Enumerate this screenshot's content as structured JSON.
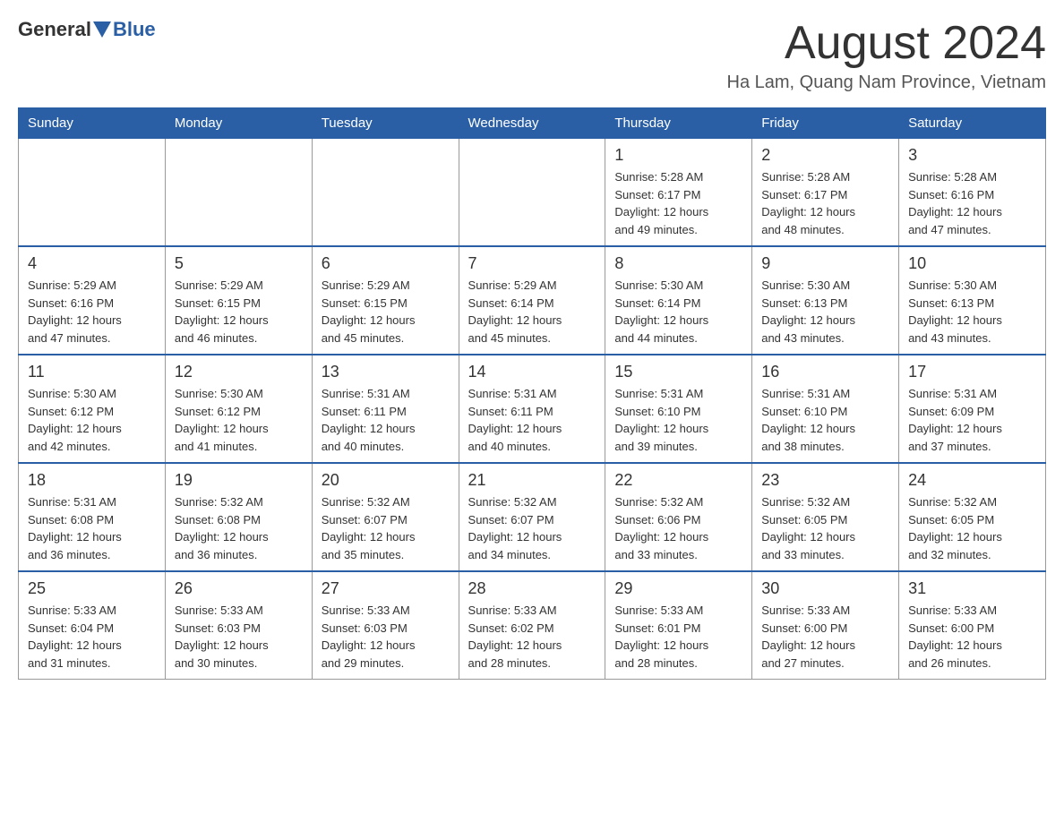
{
  "header": {
    "logo_general": "General",
    "logo_blue": "Blue",
    "month_title": "August 2024",
    "location": "Ha Lam, Quang Nam Province, Vietnam"
  },
  "weekdays": [
    "Sunday",
    "Monday",
    "Tuesday",
    "Wednesday",
    "Thursday",
    "Friday",
    "Saturday"
  ],
  "weeks": [
    [
      {
        "day": "",
        "info": ""
      },
      {
        "day": "",
        "info": ""
      },
      {
        "day": "",
        "info": ""
      },
      {
        "day": "",
        "info": ""
      },
      {
        "day": "1",
        "info": "Sunrise: 5:28 AM\nSunset: 6:17 PM\nDaylight: 12 hours\nand 49 minutes."
      },
      {
        "day": "2",
        "info": "Sunrise: 5:28 AM\nSunset: 6:17 PM\nDaylight: 12 hours\nand 48 minutes."
      },
      {
        "day": "3",
        "info": "Sunrise: 5:28 AM\nSunset: 6:16 PM\nDaylight: 12 hours\nand 47 minutes."
      }
    ],
    [
      {
        "day": "4",
        "info": "Sunrise: 5:29 AM\nSunset: 6:16 PM\nDaylight: 12 hours\nand 47 minutes."
      },
      {
        "day": "5",
        "info": "Sunrise: 5:29 AM\nSunset: 6:15 PM\nDaylight: 12 hours\nand 46 minutes."
      },
      {
        "day": "6",
        "info": "Sunrise: 5:29 AM\nSunset: 6:15 PM\nDaylight: 12 hours\nand 45 minutes."
      },
      {
        "day": "7",
        "info": "Sunrise: 5:29 AM\nSunset: 6:14 PM\nDaylight: 12 hours\nand 45 minutes."
      },
      {
        "day": "8",
        "info": "Sunrise: 5:30 AM\nSunset: 6:14 PM\nDaylight: 12 hours\nand 44 minutes."
      },
      {
        "day": "9",
        "info": "Sunrise: 5:30 AM\nSunset: 6:13 PM\nDaylight: 12 hours\nand 43 minutes."
      },
      {
        "day": "10",
        "info": "Sunrise: 5:30 AM\nSunset: 6:13 PM\nDaylight: 12 hours\nand 43 minutes."
      }
    ],
    [
      {
        "day": "11",
        "info": "Sunrise: 5:30 AM\nSunset: 6:12 PM\nDaylight: 12 hours\nand 42 minutes."
      },
      {
        "day": "12",
        "info": "Sunrise: 5:30 AM\nSunset: 6:12 PM\nDaylight: 12 hours\nand 41 minutes."
      },
      {
        "day": "13",
        "info": "Sunrise: 5:31 AM\nSunset: 6:11 PM\nDaylight: 12 hours\nand 40 minutes."
      },
      {
        "day": "14",
        "info": "Sunrise: 5:31 AM\nSunset: 6:11 PM\nDaylight: 12 hours\nand 40 minutes."
      },
      {
        "day": "15",
        "info": "Sunrise: 5:31 AM\nSunset: 6:10 PM\nDaylight: 12 hours\nand 39 minutes."
      },
      {
        "day": "16",
        "info": "Sunrise: 5:31 AM\nSunset: 6:10 PM\nDaylight: 12 hours\nand 38 minutes."
      },
      {
        "day": "17",
        "info": "Sunrise: 5:31 AM\nSunset: 6:09 PM\nDaylight: 12 hours\nand 37 minutes."
      }
    ],
    [
      {
        "day": "18",
        "info": "Sunrise: 5:31 AM\nSunset: 6:08 PM\nDaylight: 12 hours\nand 36 minutes."
      },
      {
        "day": "19",
        "info": "Sunrise: 5:32 AM\nSunset: 6:08 PM\nDaylight: 12 hours\nand 36 minutes."
      },
      {
        "day": "20",
        "info": "Sunrise: 5:32 AM\nSunset: 6:07 PM\nDaylight: 12 hours\nand 35 minutes."
      },
      {
        "day": "21",
        "info": "Sunrise: 5:32 AM\nSunset: 6:07 PM\nDaylight: 12 hours\nand 34 minutes."
      },
      {
        "day": "22",
        "info": "Sunrise: 5:32 AM\nSunset: 6:06 PM\nDaylight: 12 hours\nand 33 minutes."
      },
      {
        "day": "23",
        "info": "Sunrise: 5:32 AM\nSunset: 6:05 PM\nDaylight: 12 hours\nand 33 minutes."
      },
      {
        "day": "24",
        "info": "Sunrise: 5:32 AM\nSunset: 6:05 PM\nDaylight: 12 hours\nand 32 minutes."
      }
    ],
    [
      {
        "day": "25",
        "info": "Sunrise: 5:33 AM\nSunset: 6:04 PM\nDaylight: 12 hours\nand 31 minutes."
      },
      {
        "day": "26",
        "info": "Sunrise: 5:33 AM\nSunset: 6:03 PM\nDaylight: 12 hours\nand 30 minutes."
      },
      {
        "day": "27",
        "info": "Sunrise: 5:33 AM\nSunset: 6:03 PM\nDaylight: 12 hours\nand 29 minutes."
      },
      {
        "day": "28",
        "info": "Sunrise: 5:33 AM\nSunset: 6:02 PM\nDaylight: 12 hours\nand 28 minutes."
      },
      {
        "day": "29",
        "info": "Sunrise: 5:33 AM\nSunset: 6:01 PM\nDaylight: 12 hours\nand 28 minutes."
      },
      {
        "day": "30",
        "info": "Sunrise: 5:33 AM\nSunset: 6:00 PM\nDaylight: 12 hours\nand 27 minutes."
      },
      {
        "day": "31",
        "info": "Sunrise: 5:33 AM\nSunset: 6:00 PM\nDaylight: 12 hours\nand 26 minutes."
      }
    ]
  ]
}
